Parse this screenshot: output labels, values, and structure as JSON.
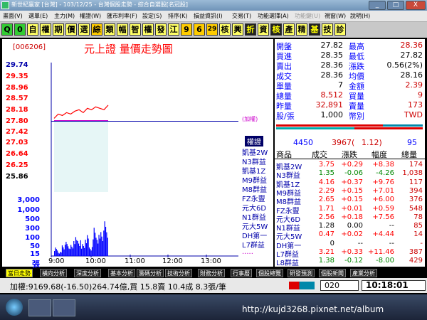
{
  "window": {
    "title": "新世紀贏家 [台灣] - 103/12/25 - 台灣個股走勢 - 綜合自選股[名冠股]",
    "min_label": "_",
    "max_label": "□",
    "close_label": "X"
  },
  "menubar": {
    "items": [
      "畫面(V)",
      "選單(E)",
      "主力(M)",
      "權證(W)",
      "匯市利率(F)",
      "設定(S)",
      "排序(K)",
      "損益資訊(I)",
      "交易(T)",
      "功能選擇(A)",
      "功能鍵(U)",
      "視窗(W)",
      "說明(H)"
    ]
  },
  "toolbar": {
    "buttons": [
      "Q",
      "0",
      "自",
      "權",
      "期",
      "價",
      "選",
      "綜",
      "類",
      "幅",
      "智",
      "權",
      "發",
      "江",
      "9",
      "6",
      "29",
      "核",
      "興",
      "折",
      "資",
      "核",
      "產",
      "精",
      "基",
      "技",
      "診"
    ]
  },
  "chart": {
    "stock_code": "[006206]",
    "stock_name": "元上證 量價走勢圖",
    "price_ticks": [
      "29.74",
      "29.35",
      "28.96",
      "28.57",
      "28.18",
      "27.80",
      "27.42",
      "27.03",
      "26.64",
      "26.25",
      "25.86"
    ],
    "volume_ticks": [
      "3,000",
      "1,000",
      "500",
      "300",
      "100",
      "50",
      "15",
      "張"
    ],
    "time_ticks": [
      "9:00",
      "10:00",
      "11:00",
      "12:00",
      "13:00"
    ],
    "ref_label": "(加權)",
    "warrant_header": "權證",
    "warrants": [
      "凱基2W",
      "N3群益",
      "凱基1Z",
      "M9群益",
      "M8群益",
      "FZ永豐",
      "元大6D",
      "N1群益",
      "元大5W",
      "DH第一",
      "L7群益",
      "....."
    ]
  },
  "chart_data": {
    "type": "line",
    "x": [
      "9:00",
      "9:05",
      "9:10",
      "9:15",
      "9:20",
      "9:25",
      "9:30",
      "9:35",
      "9:40",
      "9:45",
      "9:50",
      "9:55",
      "10:00",
      "10:05"
    ],
    "series": [
      {
        "values": [
          27.9,
          28.05,
          28.0,
          28.1,
          28.05,
          28.15,
          28.2,
          28.1,
          28.25,
          28.2,
          28.3,
          28.25,
          28.2,
          28.36
        ]
      }
    ],
    "volume": [
      60,
      30,
      80,
      90,
      70,
      120,
      100,
      80,
      140,
      60,
      200,
      150,
      180,
      220
    ],
    "ylim": [
      25.86,
      29.74
    ],
    "reference_price": 27.8
  },
  "quote": {
    "rows": [
      {
        "l1": "開盤",
        "v1": "27.82",
        "l2": "最高",
        "v2": "28.36"
      },
      {
        "l1": "買進",
        "v1": "28.35",
        "l2": "最低",
        "v2": "27.82"
      },
      {
        "l1": "賣出",
        "v1": "28.36",
        "l2": "漲跌",
        "v2": "0.56(2%)"
      },
      {
        "l1": "成交",
        "v1": "28.36",
        "l2": "均價",
        "v2": "28.16"
      },
      {
        "l1": "單量",
        "v1": "7",
        "l2": "金額",
        "v2": "2.39"
      },
      {
        "l1": "總量",
        "v1": "8,512",
        "l2": "買量",
        "v2": "9"
      },
      {
        "l1": "昨量",
        "v1": "32,891",
        "l2": "賣量",
        "v2": "173"
      },
      {
        "l1": "股/張",
        "v1": "1,000",
        "l2": "幣別",
        "v2": "TWD"
      }
    ],
    "buy_sell": "4450",
    "mid": "3967(",
    "ratio": "1.12)",
    "right_num": "95"
  },
  "list": {
    "headers": [
      "商品",
      "成交",
      "漲跌",
      "幅度",
      "總量"
    ],
    "rows": [
      {
        "name": "凱基2W",
        "price": "3.75",
        "chg": "+0.29",
        "pct": "+8.38",
        "vol": "174"
      },
      {
        "name": "N3群益",
        "price": "1.35",
        "chg": "-0.06",
        "pct": "-4.26",
        "vol": "1,038"
      },
      {
        "name": "凱基1Z",
        "price": "4.16",
        "chg": "+0.37",
        "pct": "+9.76",
        "vol": "117"
      },
      {
        "name": "M9群益",
        "price": "2.29",
        "chg": "+0.15",
        "pct": "+7.01",
        "vol": "394"
      },
      {
        "name": "M8群益",
        "price": "2.65",
        "chg": "+0.15",
        "pct": "+6.00",
        "vol": "376"
      },
      {
        "name": "FZ永豐",
        "price": "1.71",
        "chg": "+0.01",
        "pct": "+0.59",
        "vol": "548"
      },
      {
        "name": "元大6D",
        "price": "2.56",
        "chg": "+0.18",
        "pct": "+7.56",
        "vol": "78"
      },
      {
        "name": "N1群益",
        "price": "1.28",
        "chg": "0.00",
        "pct": "--",
        "vol": "85"
      },
      {
        "name": "元大5W",
        "price": "0.47",
        "chg": "+0.02",
        "pct": "+4.44",
        "vol": "14"
      },
      {
        "name": "DH第一",
        "price": "0",
        "chg": "--",
        "pct": "--",
        "vol": "-"
      },
      {
        "name": "L7群益",
        "price": "3.21",
        "chg": "+0.33",
        "pct": "+11.46",
        "vol": "387"
      },
      {
        "name": "L8群益",
        "price": "1.38",
        "chg": "-0.12",
        "pct": "-8.00",
        "vol": "429"
      }
    ]
  },
  "tabs": [
    "當日走勢",
    "橫向分析",
    "深度分析",
    "基本分析",
    "籌碼分析",
    "技術分析",
    "財務分析",
    "行事曆",
    "個股總覽",
    "研發預測",
    "個股新聞",
    "產業分析"
  ],
  "status": {
    "index_text": "加權:9169.68(-16.50)264.74億,買 15.8賣 10.4成 8.3張/筆",
    "code_box": "020",
    "time": "10:18:01"
  },
  "taskbar": {
    "url": "http://kujd3268.pixnet.net/album"
  },
  "colors": {
    "up": "#ff0000",
    "down": "#00aa00",
    "accent": "#0000ff"
  }
}
